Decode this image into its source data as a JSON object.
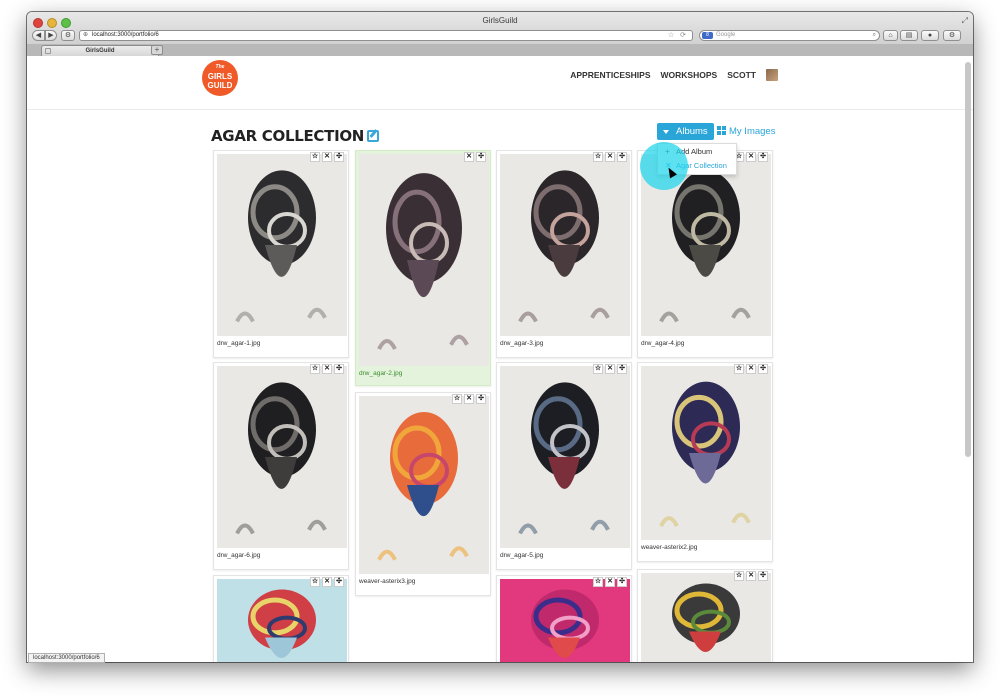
{
  "window": {
    "title": "GirlsGuild"
  },
  "browser": {
    "url": "localhost:3000/portfolio/6",
    "search_placeholder": "Google",
    "search_engine_badge": "8",
    "tab_label": "GirlsGuild",
    "status_url": "localhost:3000/portfolio/6"
  },
  "site": {
    "logo_the": "The",
    "logo_line1": "GIRLS",
    "logo_line2": "GUILD",
    "nav": {
      "apprenticeships": "APPRENTICESHIPS",
      "workshops": "WORKSHOPS",
      "user": "SCOTT"
    }
  },
  "page": {
    "title": "AGAR COLLECTION",
    "albums_button": "Albums",
    "my_images_link": "My Images",
    "dropdown": {
      "add_album": "Add Album",
      "agar_collection": "Agar Collection"
    }
  },
  "colors": {
    "accent": "#2aa5d8",
    "logo": "#f05a28",
    "selected_card": "#e4f4dc",
    "click_halo": "#1fd6ec"
  },
  "card_actions": {
    "star": "☆",
    "remove": "✕",
    "move": "✣"
  },
  "cards": [
    {
      "caption": "drw_agar-1.jpg",
      "selected": false,
      "actions": [
        "star",
        "remove",
        "move"
      ]
    },
    {
      "caption": "drw_agar-2.jpg",
      "selected": true,
      "actions": [
        "remove",
        "move"
      ]
    },
    {
      "caption": "drw_agar-3.jpg",
      "selected": false,
      "actions": [
        "star",
        "remove",
        "move"
      ]
    },
    {
      "caption": "drw_agar-4.jpg",
      "selected": false,
      "actions": [
        "star",
        "remove",
        "move"
      ]
    },
    {
      "caption": "drw_agar-6.jpg",
      "selected": false,
      "actions": [
        "star",
        "remove",
        "move"
      ]
    },
    {
      "caption": "weaver-asterix3.jpg",
      "selected": false,
      "actions": [
        "star",
        "remove",
        "move"
      ]
    },
    {
      "caption": "drw_agar-5.jpg",
      "selected": false,
      "actions": [
        "star",
        "remove",
        "move"
      ]
    },
    {
      "caption": "weaver-asterix2.jpg",
      "selected": false,
      "actions": [
        "star",
        "remove",
        "move"
      ]
    },
    {
      "caption": "",
      "selected": false,
      "actions": [
        "star",
        "remove",
        "move"
      ]
    },
    {
      "caption": "",
      "selected": false,
      "actions": [
        "star",
        "remove",
        "move"
      ]
    },
    {
      "caption": "",
      "selected": false,
      "actions": [
        "star",
        "remove",
        "move"
      ]
    }
  ]
}
